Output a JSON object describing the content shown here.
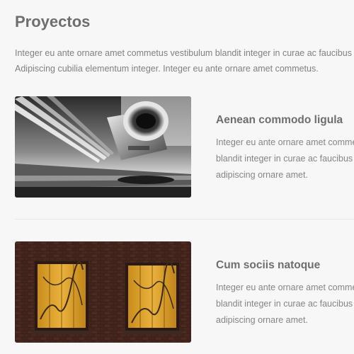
{
  "page": {
    "title": "Proyectos",
    "intro": [
      "Integer eu ante ornare amet commetus vestibulum blandit integer in curae ac faucibus integer",
      "Adipiscing cubilia elementum integer. Integer eu ante ornare amet commetus."
    ]
  },
  "projects": [
    {
      "title": "Aenean commodo ligula",
      "image": "jet-engine-photo",
      "text": [
        "Integer eu ante ornare amet commetus vestibulum",
        "blandit integer in curae ac faucibus integer",
        "adipiscing ornare amet."
      ]
    },
    {
      "title": "Cum sociis natoque",
      "image": "brick-wall-windows-photo",
      "text": [
        "Integer eu ante ornare amet commetus vestibulum",
        "blandit integer in curae ac faucibus integer",
        "adipiscing ornare amet."
      ]
    }
  ]
}
